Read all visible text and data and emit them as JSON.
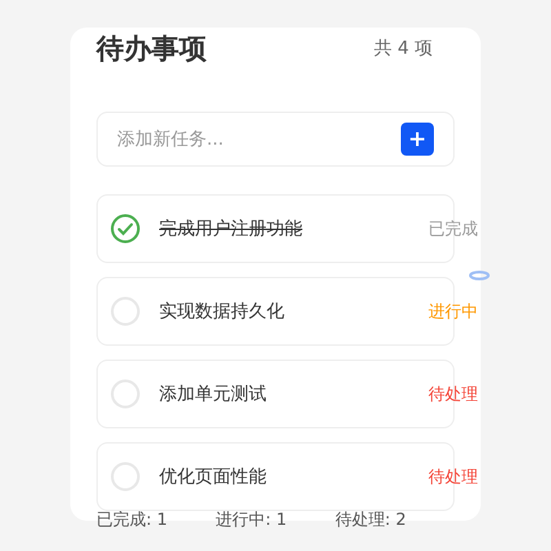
{
  "title": "待办事项",
  "count": "共 4 项",
  "input": {
    "placeholder": "添加新任务...",
    "button": "+"
  },
  "tasks": [
    {
      "text": "完成用户注册功能",
      "checked": true,
      "status": "已完成",
      "kind": "done"
    },
    {
      "text": "实现数据持久化",
      "checked": false,
      "status": "进行中",
      "kind": "progress"
    },
    {
      "text": "添加单元测试",
      "checked": false,
      "status": "待处理",
      "kind": "pending"
    },
    {
      "text": "优化页面性能",
      "checked": false,
      "status": "待处理",
      "kind": "pending"
    }
  ],
  "stats": [
    "已完成: 1",
    "进行中: 1",
    "待处理: 2"
  ]
}
